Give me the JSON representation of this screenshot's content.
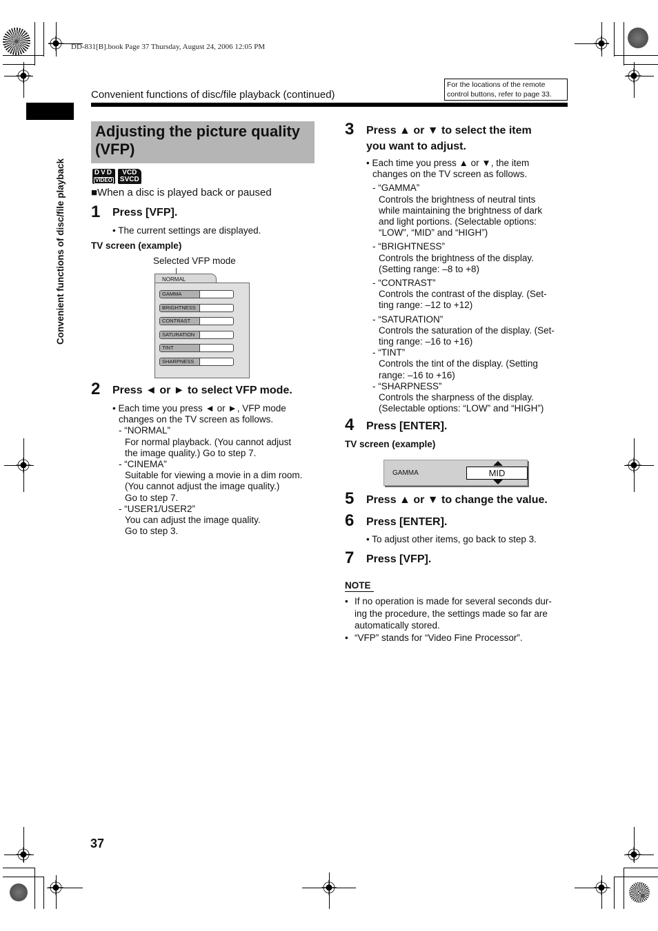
{
  "print_info": "DD-831[B].book  Page 37  Thursday, August 24, 2006  12:05 PM",
  "running_head": "Convenient functions of disc/file playback (continued)",
  "reference_box": {
    "line1": "For the locations of the remote",
    "line2": "control buttons, refer to page 33."
  },
  "side_tab_text": "Convenient functions of disc/file playback",
  "section_title_line1": "Adjusting the picture quality",
  "section_title_line2": "(VFP)",
  "badges": [
    {
      "line1": "DVD",
      "line2": "VIDEO"
    },
    {
      "line1": "VCD",
      "line2": "SVCD"
    }
  ],
  "condition": "■When a disc is played back or paused",
  "left_column": {
    "step1": {
      "number": "1",
      "title": "Press [VFP].",
      "bullet": "• The current settings are displayed.",
      "tv_label": "TV screen (example)",
      "tv_caption": "Selected VFP mode"
    },
    "tv_screen_1": {
      "mode": "NORMAL",
      "items": [
        "GAMMA",
        "BRIGHTNESS",
        "CONTRAST",
        "SATURATION",
        "TINT",
        "SHARPNESS"
      ]
    },
    "step2": {
      "number": "2",
      "title": "Press ◄ or ► to select VFP mode.",
      "lines": [
        "• Each time you press ◄ or ►, VFP mode",
        "changes on the TV screen as follows.",
        "- “NORMAL”",
        "For normal playback. (You cannot adjust",
        "the image quality.) Go to step 7.",
        "- “CINEMA”",
        "Suitable for viewing a movie in a dim room.",
        "(You cannot adjust the image quality.)",
        "Go to step 7.",
        "- “USER1/USER2”",
        "You can adjust the image quality.",
        "Go to step 3."
      ]
    }
  },
  "right_column": {
    "step3": {
      "number": "3",
      "title_line1": "Press ▲ or ▼ to select the item",
      "title_line2": "you want to adjust.",
      "lines": [
        "• Each time you press ▲ or ▼, the item",
        "changes on the TV screen as follows.",
        "- “GAMMA”",
        "Controls the brightness of neutral tints",
        "while maintaining the brightness of dark",
        "and light portions. (Selectable options:",
        "“LOW”, “MID” and “HIGH”)",
        "- “BRIGHTNESS”",
        "Controls the brightness of the display.",
        "(Setting range: –8 to +8)",
        "- “CONTRAST”",
        "Controls the contrast of the display. (Set-",
        "ting range: –12 to +12)",
        "- “SATURATION”",
        "Controls the saturation of the display. (Set-",
        "ting range: –16 to +16)",
        "- “TINT”",
        "Controls the tint of the display. (Setting",
        "range: –16 to +16)",
        "- “SHARPNESS”",
        "Controls the sharpness of the display.",
        "(Selectable options: “LOW” and “HIGH”)"
      ]
    },
    "step4": {
      "number": "4",
      "title": "Press [ENTER].",
      "tv_label": "TV screen (example)"
    },
    "tv_screen_2": {
      "item": "GAMMA",
      "value": "MID"
    },
    "step5": {
      "number": "5",
      "title": "Press ▲ or ▼ to change the value."
    },
    "step6": {
      "number": "6",
      "title": "Press [ENTER].",
      "bullet": "• To adjust other items, go back to step 3."
    },
    "step7": {
      "number": "7",
      "title": "Press [VFP]."
    },
    "note": {
      "heading": "NOTE",
      "items": [
        {
          "lines": [
            "If no operation is made for several seconds dur-",
            "ing the procedure, the settings made so far are",
            "automatically stored."
          ]
        },
        {
          "lines": [
            "“VFP” stands for “Video Fine Processor”."
          ]
        }
      ]
    }
  },
  "page_number": "37"
}
